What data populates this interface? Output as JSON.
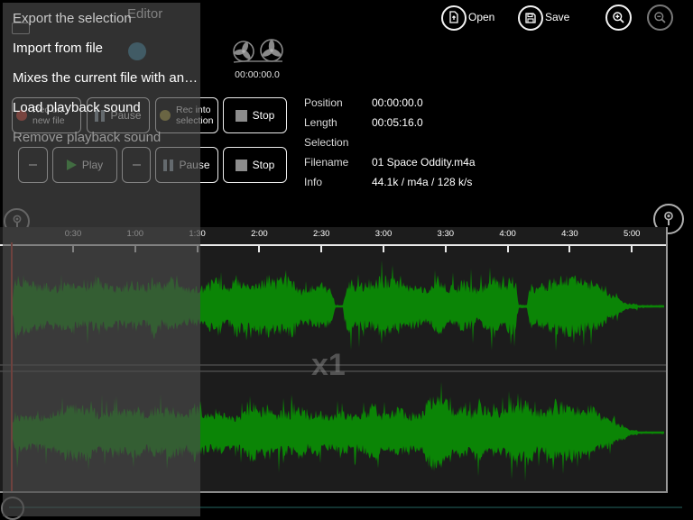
{
  "window": {
    "title": "Editor"
  },
  "context_menu": {
    "items": [
      {
        "label": "Export the selection"
      },
      {
        "label": "Import from file"
      },
      {
        "label": "Mixes the current file with an…"
      },
      {
        "label": "Load playback sound"
      },
      {
        "label": "Remove playback sound"
      }
    ]
  },
  "toolbar": {
    "open_label": "Open",
    "save_label": "Save"
  },
  "tape_display": {
    "timecode": "00:00:00.0"
  },
  "info_panel": {
    "rows": [
      {
        "label": "Position",
        "value": "00:00:00.0"
      },
      {
        "label": "Length",
        "value": "00:05:16.0"
      },
      {
        "label": "Selection",
        "value": ""
      },
      {
        "label": "Filename",
        "value": "01 Space Oddity.m4a"
      },
      {
        "label": "Info",
        "value": "44.1k / m4a / 128 k/s"
      }
    ]
  },
  "transport": {
    "rec_new_label": "Rec on new file",
    "pause_label": "Pause",
    "rec_selection_label": "Rec into selection",
    "stop_label": "Stop",
    "play_label": "Play"
  },
  "timeline": {
    "labels": [
      "0:30",
      "1:00",
      "1:30",
      "2:00",
      "2:30",
      "3:00",
      "3:30",
      "4:00",
      "4:30",
      "5:00"
    ],
    "zoom_level_label": "x1"
  },
  "waveform": {
    "color": "#0b8506"
  }
}
